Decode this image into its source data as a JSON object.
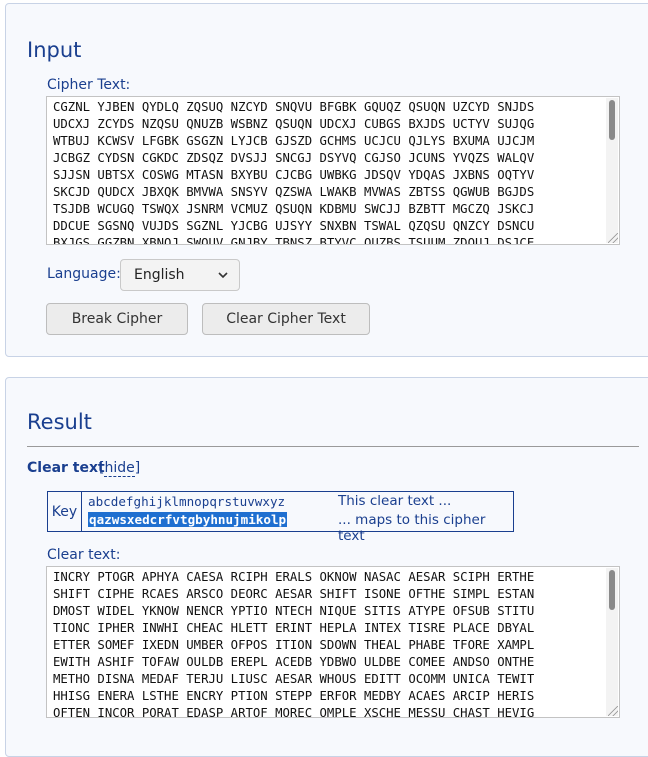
{
  "input": {
    "title": "Input",
    "cipher_label": "Cipher Text:",
    "cipher_text": "CGZNL YJBEN QYDLQ ZQSUQ NZCYD SNQVU BFGBK GQUQZ QSUQN UZCYD SNJDS\nUDCXJ ZCYDS NZQSU QNUZB WSBNZ QSUQN UDCXJ CUBGS BXJDS UCTYV SUJQG\nWTBUJ KCWSV LFGBK GSGZN LYJCB GJSZD GCHMS UCJCU QJLYS BXUMA UJCJM\nJCBGZ CYDSN CGKDC ZDSQZ DVSJJ SNCGJ DSYVQ CGJSO JCUNS YVQZS WALQV\nSJJSN UBTSX COSWG MTASN BXYBU CJCBG UWBKG JDSQV YDQAS JXBNS OQTYV\nSKCJD QUDCX JBXQK BMVWA SNSYV QZSWA LWAKB MVWAS ZBTSS QGWUB BGJDS\nTSJDB WCUGQ TSWQX JSNRM VCMUZ QSUQN KDBMU SWCJJ BZBTT MGCZQ JSKCJ\nDDCUE SGSNQ VUJDS SGZNL YJCBG UJSYY SNXBN TSWAL QZQSU QNZCY DSNCU\nBXJGS GGZBN XBNOJ SWOUV GNJBY TBNSZ BTYVC OUZBS TSUUM ZDOUJ DSJCE",
    "language_label": "Language:",
    "language_value": "English",
    "break_button": "Break Cipher",
    "clear_button": "Clear Cipher Text"
  },
  "result": {
    "title": "Result",
    "clear_text_heading": "Clear text",
    "hide_link": "hide",
    "key_label": "Key",
    "plain_alphabet": "abcdefghijklmnopqrstuvwxyz",
    "cipher_alphabet": "qazwsxedcrfvtgbyhnujmikolp",
    "note_plain": "This clear text ...",
    "note_cipher": "... maps to this cipher text",
    "clear_label": "Clear text:",
    "clear_text": "INCRY PTOGR APHYA CAESA RCIPH ERALS OKNOW NASAC AESAR SCIPH ERTHE\nSHIFT CIPHE RCAES ARSCO DEORC AESAR SHIFT ISONE OFTHE SIMPL ESTAN\nDMOST WIDEL YKNOW NENCR YPTIO NTECH NIQUE SITIS ATYPE OFSUB STITU\nTIONC IPHER INWHI CHEAC HLETT ERINT HEPLA INTEX TISRE PLACE DBYAL\nETTER SOMEF IXEDN UMBER OFPOS ITION SDOWN THEAL PHABE TFORE XAMPL\nEWITH ASHIF TOFAW OULDB EREPL ACEDB YDBWO ULDBE COMEE ANDSO ONTHE\nMETHO DISNA MEDAF TERJU LIUSC AESAR WHOUS EDITT OCOMM UNICA TEWIT\nHHISG ENERA LSTHE ENCRY PTION STEPP ERFOR MEDBY ACAES ARCIP HERIS\nOFTEN INCOR PORAT EDASP ARTOF MOREC OMPLE XSCHE MESSU CHAST HEVIG"
  }
}
